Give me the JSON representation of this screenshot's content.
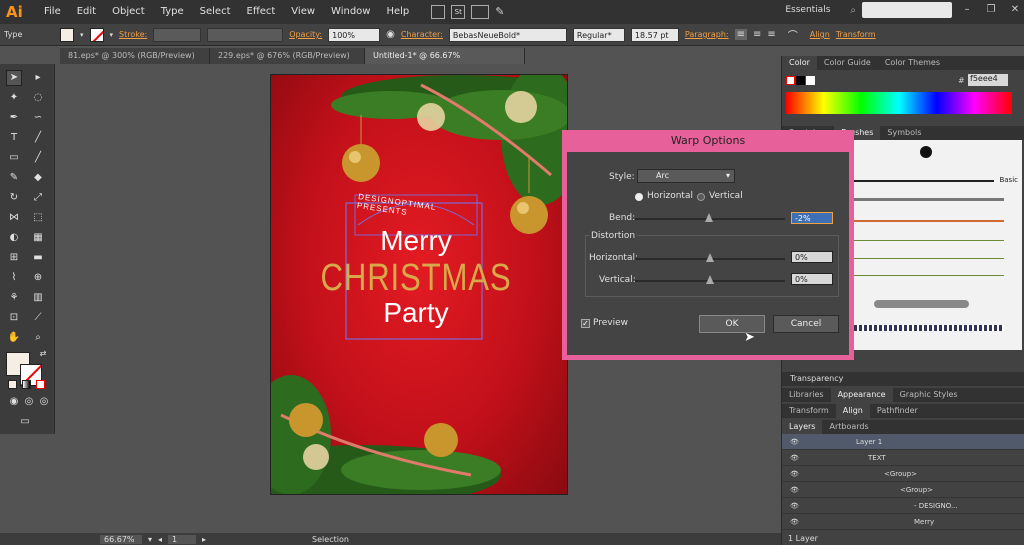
{
  "app": {
    "logo": "Ai"
  },
  "menu": [
    "File",
    "Edit",
    "Object",
    "Type",
    "Select",
    "Effect",
    "View",
    "Window",
    "Help"
  ],
  "workspace": "Essentials",
  "control": {
    "type_label": "Type",
    "stroke_label": "Stroke:",
    "opacity_label": "Opacity:",
    "opacity_value": "100%",
    "character_label": "Character:",
    "font_value": "BebasNeueBold*",
    "style_value": "Regular*",
    "size_value": "18.57 pt",
    "paragraph_label": "Paragraph:",
    "align_label": "Align",
    "transform_label": "Transform"
  },
  "doc_tabs": [
    {
      "label": "81.eps* @ 300% (RGB/Preview)"
    },
    {
      "label": "229.eps* @ 676% (RGB/Preview)"
    },
    {
      "label": "Untitled-1* @ 66.67% (RGB/Preview)"
    }
  ],
  "artwork": {
    "arc_text": "DESIGNOPTIMAL PRESENTS",
    "line1": "Merry",
    "line2": "CHRISTMAS",
    "line3": "Party"
  },
  "status": {
    "zoom": "66.67%",
    "page": "1",
    "tool": "Selection"
  },
  "color_panel": {
    "tabs": [
      "Color",
      "Color Guide",
      "Color Themes"
    ],
    "hex": "f5eee4"
  },
  "brushes_panel": {
    "tabs": [
      "Swatches",
      "Brushes",
      "Symbols"
    ],
    "basic_label": "Basic"
  },
  "mid_panels": {
    "transparency": "Transparency",
    "row1": [
      "Libraries",
      "Appearance",
      "Graphic Styles"
    ],
    "row2": [
      "Transform",
      "Align",
      "Pathfinder"
    ]
  },
  "layers_panel": {
    "tabs": [
      "Layers",
      "Artboards"
    ],
    "rows": [
      {
        "name": "Layer 1"
      },
      {
        "name": "TEXT"
      },
      {
        "name": "<Group>"
      },
      {
        "name": "<Group>"
      },
      {
        "name": "- DESIGNO..."
      },
      {
        "name": "Merry"
      }
    ],
    "footer": "1 Layer"
  },
  "warp_dialog": {
    "title": "Warp Options",
    "style_label": "Style:",
    "style_value": "Arc",
    "horizontal": "Horizontal",
    "vertical": "Vertical",
    "bend_label": "Bend:",
    "bend_value": "-2%",
    "distortion_label": "Distortion",
    "dist_h_label": "Horizontal:",
    "dist_h_value": "0%",
    "dist_v_label": "Vertical:",
    "dist_v_value": "0%",
    "preview": "Preview",
    "ok": "OK",
    "cancel": "Cancel"
  }
}
